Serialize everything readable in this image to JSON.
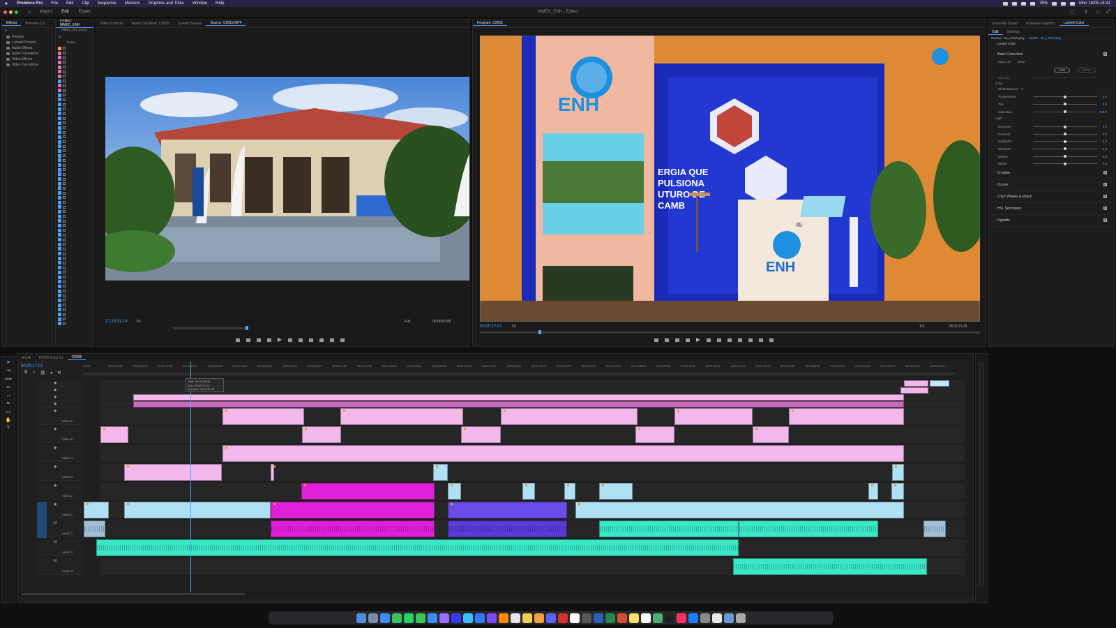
{
  "menubar": {
    "app_name": "Premiere Pro",
    "items": [
      "File",
      "Edit",
      "Clip",
      "Sequence",
      "Markers",
      "Graphics and Titles",
      "Window",
      "Help"
    ],
    "battery": "76%",
    "datetime": "Mon 18/05 18:41"
  },
  "appbar": {
    "tabs": [
      "Import",
      "Edit",
      "Export"
    ],
    "active_tab": "Edit",
    "document_title": "MMEC_ENH - Edited"
  },
  "effects_panel": {
    "tabs": [
      "Effects",
      "Premiere Co",
      "Project: MMEC_ENH"
    ],
    "tree": [
      "Presets",
      "Lumetri Presets",
      "Audio Effects",
      "Audio Transitions",
      "Video Effects",
      "Video Transitions"
    ],
    "project_file": "MMEC_EN..prproj",
    "name_column": "Name"
  },
  "source_monitor": {
    "tabs": [
      "Effect Controls",
      "Audio Clip Mixer: C0055",
      "Lumetri Scopes",
      "Source: C0019.MP4"
    ],
    "timecode": "17;29;31;19",
    "fit": "Fit",
    "quality": "Full",
    "duration": "00;00;02;06"
  },
  "program_monitor": {
    "tab": "Program: C0055",
    "timecode": "00;00;17;01",
    "fit": "Fit",
    "resolution": "1/4",
    "duration": "00;02;21;19",
    "booth_text_1": "ENH",
    "booth_text_2": "ERGIA QUE",
    "booth_text_3": "PULSIONA",
    "booth_text_4": "UTURO DE",
    "booth_text_5": "CAMB",
    "logo_number": "45"
  },
  "lumetri": {
    "tabs": [
      "Essential Sound",
      "Essential Graphics",
      "Lumetri Color"
    ],
    "subtabs": [
      "Edit",
      "Settings"
    ],
    "source": "Source - 45_LOGO.png",
    "clip": "C0055 - 45_LOGO.png",
    "effect": "Lumetri Color",
    "basic_correction": "Basic Correction",
    "input_lut_label": "Input LUT",
    "input_lut_value": "None",
    "auto_button": "Auto",
    "reset_button": "Reset",
    "intensity": "Intensity",
    "color_label": "Color",
    "white_balance": "White Balance",
    "sliders_color": [
      {
        "label": "Temperature",
        "value": "0.0",
        "position": 0.5
      },
      {
        "label": "Tint",
        "value": "0.0",
        "position": 0.5
      },
      {
        "label": "Saturation",
        "value": "100.0",
        "position": 0.5
      }
    ],
    "light_label": "Light",
    "sliders_light": [
      {
        "label": "Exposure",
        "value": "0.0",
        "position": 0.5
      },
      {
        "label": "Contrast",
        "value": "0.0",
        "position": 0.5
      },
      {
        "label": "Highlights",
        "value": "0.0",
        "position": 0.5
      },
      {
        "label": "Shadows",
        "value": "0.0",
        "position": 0.5
      },
      {
        "label": "Whites",
        "value": "0.0",
        "position": 0.5
      },
      {
        "label": "Blacks",
        "value": "0.0",
        "position": 0.5
      }
    ],
    "sections": [
      "Creative",
      "Curves",
      "Color Wheels & Match",
      "HSL Secondary",
      "Vignette"
    ]
  },
  "timeline": {
    "tabs": [
      "(Inc)4",
      "C0055 Copy 01",
      "C0055"
    ],
    "timecode": "00;00;17;01",
    "ruler": [
      "00;00",
      "00;00;04;00",
      "00;00;08;00",
      "00;00;12;00",
      "00;00;16;00",
      "00;00;20;00",
      "00;00;24;00",
      "00;00;28;00",
      "00;00;32;00",
      "00;00;36;00",
      "00;00;40;00",
      "00;00;44;00",
      "00;00;48;00",
      "00;00;52;00",
      "00;00;56;00",
      "00;01;00;02",
      "00;01;04;02",
      "00;01;08;02",
      "00;01;12;02",
      "00;01;16;02",
      "00;01;20;02",
      "00;01;24;02",
      "00;01;28;02",
      "00;01;32;02",
      "00;01;36;02",
      "00;01;40;02",
      "00;01;44;02",
      "00;01;48;02",
      "00;01;52;02",
      "00;01;56;02",
      "00;02;00;04",
      "00;02;04;04",
      "00;02;08;04",
      "00;02;12;04",
      "00;02;16;04"
    ],
    "tooltip": {
      "start": "Start: 00;00;00;00",
      "end": "End: 00;02;21;18",
      "duration": "Duration: 00;02;21;19"
    },
    "video_tracks": [
      "Video 6",
      "Video 5",
      "Video 4",
      "Video 3",
      "Video 2",
      "Video 1"
    ],
    "audio_tracks": [
      "Audio 1",
      "Audio 2",
      "Audio 3"
    ]
  },
  "dock": {
    "apps": [
      "Finder",
      "Launchpad",
      "Safari",
      "Messages",
      "WhatsApp",
      "FaceTime",
      "Mail",
      "Ae",
      "Pr",
      "LrC",
      "Ps",
      "Me",
      "Ai",
      "Chrome",
      "Notes",
      "Photos",
      "Discord",
      "Acrobat",
      "Calendar",
      "Calculator",
      "Word",
      "Excel",
      "PowerPoint",
      "Notes2",
      "Reminders",
      "Maps",
      "TV",
      "Music",
      "App Store",
      "Settings",
      "Finder2",
      "Preview",
      "Trash"
    ],
    "colors": [
      "#4a8fe0",
      "#7c8ca8",
      "#3a8ef0",
      "#36c45a",
      "#25d366",
      "#3ac45a",
      "#3a8ef0",
      "#9a6cff",
      "#3a3aff",
      "#3ac0ff",
      "#2f78ff",
      "#7a4cff",
      "#ff8a00",
      "#e7e7e7",
      "#f4d04a",
      "#f0a040",
      "#5865f2",
      "#d63030",
      "#ffffff",
      "#555555",
      "#2b5fb8",
      "#1f8a50",
      "#d05030",
      "#f7e070",
      "#ffffff",
      "#4caf70",
      "#222222",
      "#ff3060",
      "#1a80ff",
      "#8a8a8a",
      "#e7e7e7",
      "#6a9ad0",
      "#aaaaaa"
    ]
  }
}
